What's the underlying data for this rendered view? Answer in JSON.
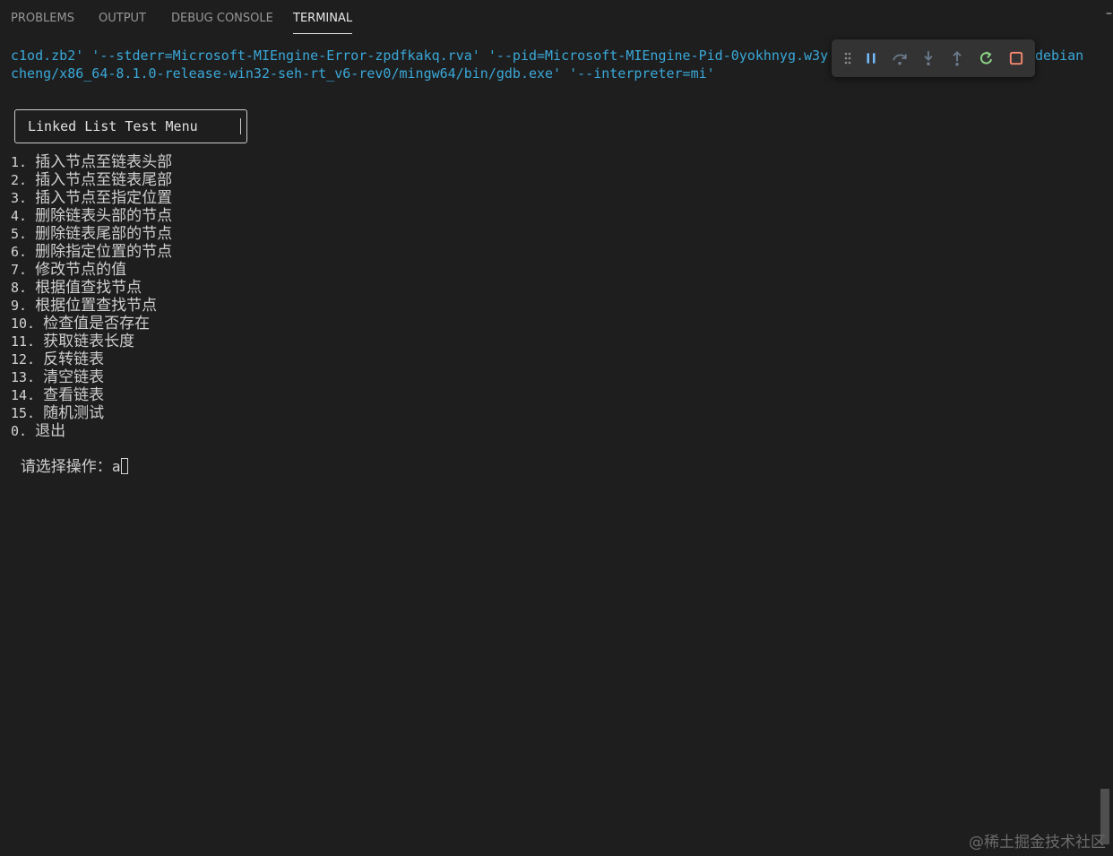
{
  "panel": {
    "tabs": [
      {
        "label": "PROBLEMS"
      },
      {
        "label": "OUTPUT"
      },
      {
        "label": "DEBUG CONSOLE"
      },
      {
        "label": "TERMINAL",
        "active": true
      }
    ]
  },
  "terminal": {
    "command_line_1": "c1od.zb2' '--stderr=Microsoft-MIEngine-Error-zpdfkakq.rva' '--pid=Microsoft-MIEngine-Pid-0yokhnyg.w3y'",
    "command_line_1_tail": "debian",
    "command_line_2": "cheng/x86_64-8.1.0-release-win32-seh-rt_v6-rev0/mingw64/bin/gdb.exe' '--interpreter=mi'",
    "menu_title": "Linked List Test Menu",
    "menu_items": [
      {
        "num": "1. ",
        "text": "插入节点至链表头部"
      },
      {
        "num": "2. ",
        "text": "插入节点至链表尾部"
      },
      {
        "num": "3. ",
        "text": "插入节点至指定位置"
      },
      {
        "num": "4. ",
        "text": "删除链表头部的节点"
      },
      {
        "num": "5. ",
        "text": "删除链表尾部的节点"
      },
      {
        "num": "6. ",
        "text": "删除指定位置的节点"
      },
      {
        "num": "7. ",
        "text": "修改节点的值"
      },
      {
        "num": "8. ",
        "text": "根据值查找节点"
      },
      {
        "num": "9. ",
        "text": "根据位置查找节点"
      },
      {
        "num": "10. ",
        "text": "检查值是否存在"
      },
      {
        "num": "11. ",
        "text": "获取链表长度"
      },
      {
        "num": "12. ",
        "text": "反转链表"
      },
      {
        "num": "13. ",
        "text": "清空链表"
      },
      {
        "num": "14. ",
        "text": "查看链表"
      },
      {
        "num": "15. ",
        "text": "随机测试"
      },
      {
        "num": "0. ",
        "text": "退出"
      }
    ],
    "prompt_label": "请选择操作：",
    "prompt_input": "a"
  },
  "debug_toolbar": {
    "buttons": [
      {
        "icon": "gripper-icon",
        "color": "#8c8c8c"
      },
      {
        "icon": "pause-icon",
        "color": "#75beff"
      },
      {
        "icon": "step-over-icon",
        "color": "#6b7b8c"
      },
      {
        "icon": "step-into-icon",
        "color": "#6b7b8c"
      },
      {
        "icon": "step-out-icon",
        "color": "#6b7b8c"
      },
      {
        "icon": "restart-icon",
        "color": "#89d185"
      },
      {
        "icon": "stop-icon",
        "color": "#f48771"
      }
    ]
  },
  "watermark": "@稀土掘金技术社区",
  "colors": {
    "background": "#1e1e1e",
    "command_text": "#3aa8d8",
    "text": "#d4d4d4"
  }
}
